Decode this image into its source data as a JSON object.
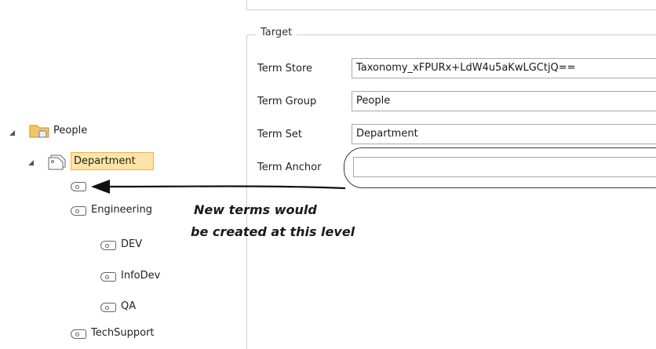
{
  "target": {
    "group_title": "Target",
    "fields": [
      {
        "label": "Term Store",
        "value": "Taxonomy_xFPURx+LdW4u5aKwLGCtjQ=="
      },
      {
        "label": "Term Group",
        "value": "People"
      },
      {
        "label": "Term Set",
        "value": "Department"
      },
      {
        "label": "Term Anchor",
        "value": ""
      }
    ]
  },
  "tree": {
    "group": "People",
    "term_set": "Department",
    "terms": [
      "",
      "Engineering",
      "DEV",
      "InfoDev",
      "QA",
      "TechSupport"
    ]
  },
  "annotation": {
    "line1": "New terms would",
    "line2": "be created at this level"
  }
}
